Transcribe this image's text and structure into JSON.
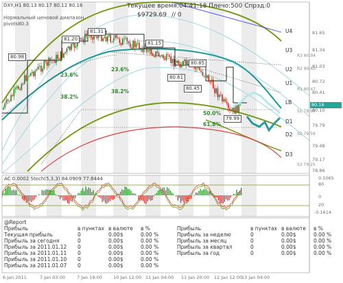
{
  "header": {
    "symbol_line": "DXY,H1  80.13 80.17 80.12 80.16",
    "note_line1": "Нормальный ценовой диапазон",
    "note_line2": "pivots80.3",
    "time_label": "Текущее время:04:41:18 Плечо:500 Спрэд:0",
    "balance": "$9729.69",
    "balance_suffix": "// 0"
  },
  "price_axis": {
    "ticks": [
      "81.65",
      "81.34",
      "81.03",
      "80.72",
      "80.41",
      "80.10",
      "79.79",
      "79.48",
      "79.17",
      "78.86"
    ],
    "current_price": "80.16",
    "level_tags": [
      "R3 80.94",
      "R2 80.63",
      "R1 80.47",
      "S1 79.93",
      "S2 79.59",
      "S3 79.25"
    ]
  },
  "levels": {
    "right": [
      "U4",
      "U3",
      "U2",
      "U1",
      "LB",
      "D1",
      "D2",
      "D3"
    ],
    "fib": [
      "23.6%",
      "23.6%",
      "38.2%",
      "38.2%",
      "50.0%",
      "61.8%"
    ]
  },
  "price_boxes": [
    "80.98",
    "81.20",
    "81.31",
    "81.15",
    "80.85",
    "80.61",
    "80.45",
    "79.99"
  ],
  "oscillator": {
    "label": "AC 0.0002  Stoch(5,3,3) 84.0909 77.8444",
    "ticks": [
      "0.1065",
      "80",
      "20",
      "0",
      "-0.1614"
    ]
  },
  "time_axis": [
    "6 Jan 2011",
    "7 Jan 03:00",
    "7 Jan 19:00",
    "10 Jan 12:00",
    "11 Jan 04:00",
    "11 Jan 20:00",
    "12 Jan 12:00",
    "13 Jan 04:00"
  ],
  "report": {
    "title": "@Report",
    "left_headers": [
      "Прибыль",
      "в пунктах",
      "в валюте",
      "в %"
    ],
    "left_rows": [
      [
        "Текущая прибыль",
        "0",
        "0.00$",
        "0.00 %"
      ],
      [
        "Прибыль за сегодня",
        "0",
        "0.00$",
        "0.00 %"
      ],
      [
        "Прибыль за 2011.01.12",
        "0",
        "0.00$",
        "0.00 %"
      ],
      [
        "Прибыль за 2011.01.11",
        "0",
        "0.00$",
        "0.00 %"
      ],
      [
        "Прибыль за 2011.01.10",
        "0",
        "0.00$",
        "0.00 %"
      ],
      [
        "Прибыль за 2011.01.07",
        "0",
        "0.00$",
        "0.00 %"
      ]
    ],
    "right_headers": [
      "Прибыль",
      "в пунктах",
      "в валюте",
      "в %"
    ],
    "right_rows": [
      [
        "Прибыль за неделю",
        "0",
        "0.00$",
        "0.00 %"
      ],
      [
        "Прибыль за месяц",
        "0",
        "0.00$",
        "0.00 %"
      ],
      [
        "Прибыль за квартал",
        "0",
        "0.00$",
        "0.00 %"
      ],
      [
        "Прибыль за год",
        "0",
        "0.00$",
        "0.00 %"
      ]
    ]
  },
  "colors": {
    "bull": "#1a8a1a",
    "bear": "#e02020",
    "cyan": "#66c8d8",
    "olive": "#7a9a18",
    "red_curve": "#e04040",
    "blue_line": "#4040ff",
    "teal_ma": "#1a9a9a",
    "current_price_bg": "#20b2aa"
  }
}
